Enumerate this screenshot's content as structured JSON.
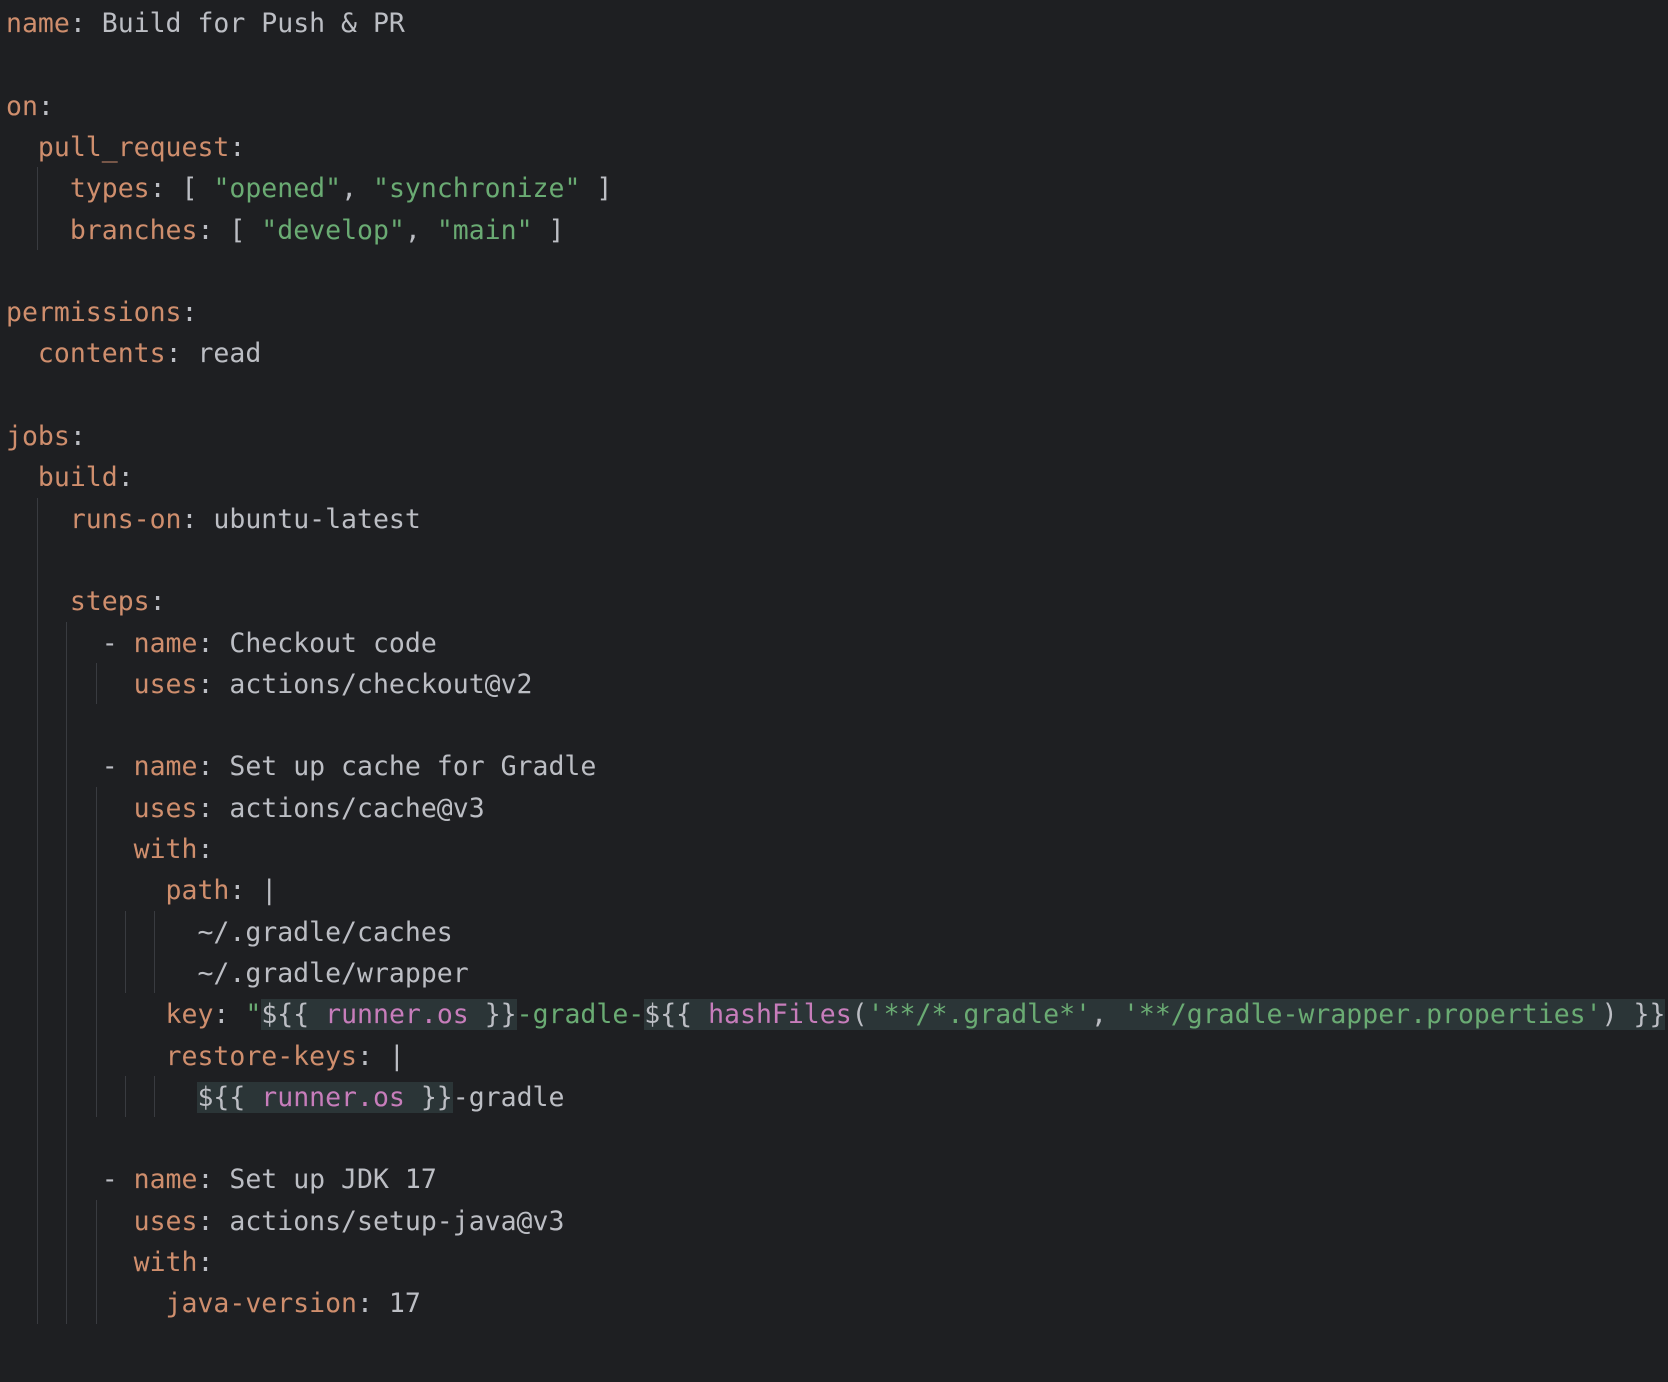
{
  "editor": {
    "language": "yaml",
    "theme_colors": {
      "background": "#1e1f22",
      "key": "#cf8e6d",
      "plain_text": "#bcbec4",
      "string": "#6aab73",
      "expression_property": "#c77dbb",
      "expression_background": "#2b3537",
      "indent_guide": "#393b40"
    },
    "lines": [
      [
        {
          "t": "key",
          "v": "name"
        },
        {
          "t": "text",
          "v": ": Build for Push & PR"
        }
      ],
      [],
      [
        {
          "t": "key",
          "v": "on"
        },
        {
          "t": "text",
          "v": ":"
        }
      ],
      [
        {
          "t": "text",
          "v": "  "
        },
        {
          "t": "key",
          "v": "pull_request"
        },
        {
          "t": "text",
          "v": ":"
        }
      ],
      [
        {
          "t": "text",
          "v": "    "
        },
        {
          "t": "key",
          "v": "types"
        },
        {
          "t": "text",
          "v": ": [ "
        },
        {
          "t": "str",
          "v": "\"opened\""
        },
        {
          "t": "text",
          "v": ", "
        },
        {
          "t": "str",
          "v": "\"synchronize\""
        },
        {
          "t": "text",
          "v": " ]"
        }
      ],
      [
        {
          "t": "text",
          "v": "    "
        },
        {
          "t": "key",
          "v": "branches"
        },
        {
          "t": "text",
          "v": ": [ "
        },
        {
          "t": "str",
          "v": "\"develop\""
        },
        {
          "t": "text",
          "v": ", "
        },
        {
          "t": "str",
          "v": "\"main\""
        },
        {
          "t": "text",
          "v": " ]"
        }
      ],
      [],
      [
        {
          "t": "key",
          "v": "permissions"
        },
        {
          "t": "text",
          "v": ":"
        }
      ],
      [
        {
          "t": "text",
          "v": "  "
        },
        {
          "t": "key",
          "v": "contents"
        },
        {
          "t": "text",
          "v": ": read"
        }
      ],
      [],
      [
        {
          "t": "key",
          "v": "jobs"
        },
        {
          "t": "text",
          "v": ":"
        }
      ],
      [
        {
          "t": "text",
          "v": "  "
        },
        {
          "t": "key",
          "v": "build"
        },
        {
          "t": "text",
          "v": ":"
        }
      ],
      [
        {
          "t": "text",
          "v": "    "
        },
        {
          "t": "key",
          "v": "runs-on"
        },
        {
          "t": "text",
          "v": ": ubuntu-latest"
        }
      ],
      [],
      [
        {
          "t": "text",
          "v": "    "
        },
        {
          "t": "key",
          "v": "steps"
        },
        {
          "t": "text",
          "v": ":"
        }
      ],
      [
        {
          "t": "text",
          "v": "      - "
        },
        {
          "t": "key",
          "v": "name"
        },
        {
          "t": "text",
          "v": ": Checkout code"
        }
      ],
      [
        {
          "t": "text",
          "v": "        "
        },
        {
          "t": "key",
          "v": "uses"
        },
        {
          "t": "text",
          "v": ": actions/checkout@v2"
        }
      ],
      [],
      [
        {
          "t": "text",
          "v": "      - "
        },
        {
          "t": "key",
          "v": "name"
        },
        {
          "t": "text",
          "v": ": Set up cache for Gradle"
        }
      ],
      [
        {
          "t": "text",
          "v": "        "
        },
        {
          "t": "key",
          "v": "uses"
        },
        {
          "t": "text",
          "v": ": actions/cache@v3"
        }
      ],
      [
        {
          "t": "text",
          "v": "        "
        },
        {
          "t": "key",
          "v": "with"
        },
        {
          "t": "text",
          "v": ":"
        }
      ],
      [
        {
          "t": "text",
          "v": "          "
        },
        {
          "t": "key",
          "v": "path"
        },
        {
          "t": "text",
          "v": ": |"
        }
      ],
      [
        {
          "t": "text",
          "v": "            ~/.gradle/caches"
        }
      ],
      [
        {
          "t": "text",
          "v": "            ~/.gradle/wrapper"
        }
      ],
      [
        {
          "t": "text",
          "v": "          "
        },
        {
          "t": "key",
          "v": "key"
        },
        {
          "t": "text",
          "v": ": "
        },
        {
          "t": "str",
          "v": "\""
        },
        {
          "t": "expr",
          "v": "${{ "
        },
        {
          "t": "prop",
          "v": "runner.os"
        },
        {
          "t": "expr",
          "v": " }}"
        },
        {
          "t": "str",
          "v": "-gradle-"
        },
        {
          "t": "expr",
          "v": "${{ "
        },
        {
          "t": "fn",
          "v": "hashFiles"
        },
        {
          "t": "expr",
          "v": "("
        },
        {
          "t": "estr",
          "v": "'**/*.gradle*'"
        },
        {
          "t": "expr",
          "v": ", "
        },
        {
          "t": "estr",
          "v": "'**/gradle-wrapper.properties'"
        },
        {
          "t": "expr",
          "v": ") }}"
        },
        {
          "t": "str",
          "v": "\""
        }
      ],
      [
        {
          "t": "text",
          "v": "          "
        },
        {
          "t": "key",
          "v": "restore-keys"
        },
        {
          "t": "text",
          "v": ": |"
        }
      ],
      [
        {
          "t": "text",
          "v": "            "
        },
        {
          "t": "expr",
          "v": "${{ "
        },
        {
          "t": "prop",
          "v": "runner.os"
        },
        {
          "t": "expr",
          "v": " }}"
        },
        {
          "t": "text",
          "v": "-gradle"
        }
      ],
      [],
      [
        {
          "t": "text",
          "v": "      - "
        },
        {
          "t": "key",
          "v": "name"
        },
        {
          "t": "text",
          "v": ": Set up JDK 17"
        }
      ],
      [
        {
          "t": "text",
          "v": "        "
        },
        {
          "t": "key",
          "v": "uses"
        },
        {
          "t": "text",
          "v": ": actions/setup-java@v3"
        }
      ],
      [
        {
          "t": "text",
          "v": "        "
        },
        {
          "t": "key",
          "v": "with"
        },
        {
          "t": "text",
          "v": ":"
        }
      ],
      [
        {
          "t": "text",
          "v": "          "
        },
        {
          "t": "key",
          "v": "java-version"
        },
        {
          "t": "text",
          "v": ": 17"
        }
      ]
    ]
  }
}
